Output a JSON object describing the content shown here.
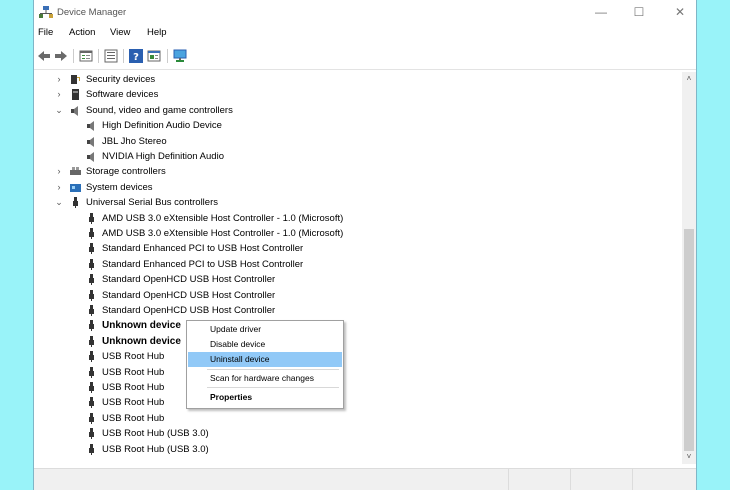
{
  "window": {
    "title": "Device Manager",
    "minimize": "—",
    "maximize": "☐",
    "close": "✕"
  },
  "menu": [
    "File",
    "Action",
    "View",
    "Help"
  ],
  "toolbar": [
    "back-icon",
    "forward-icon",
    "properties-view-icon",
    "console-tree-icon",
    "help-icon",
    "details-icon",
    "monitor-icon"
  ],
  "tree": [
    {
      "label": "Security devices",
      "chevron": "›",
      "icon": "security-device-icon",
      "level": 1
    },
    {
      "label": "Software devices",
      "chevron": "›",
      "icon": "software-device-icon",
      "level": 1
    },
    {
      "label": "Sound, video and game controllers",
      "chevron": "⌄",
      "icon": "speaker-icon",
      "level": 1
    },
    {
      "label": "High Definition Audio Device",
      "chevron": "",
      "icon": "speaker-icon",
      "level": 2
    },
    {
      "label": "JBL Jho Stereo",
      "chevron": "",
      "icon": "speaker-icon",
      "level": 2
    },
    {
      "label": "NVIDIA High Definition Audio",
      "chevron": "",
      "icon": "speaker-icon",
      "level": 2
    },
    {
      "label": "Storage controllers",
      "chevron": "›",
      "icon": "storage-controller-icon",
      "level": 1
    },
    {
      "label": "System devices",
      "chevron": "›",
      "icon": "system-device-icon",
      "level": 1
    },
    {
      "label": "Universal Serial Bus controllers",
      "chevron": "⌄",
      "icon": "usb-icon",
      "level": 1
    },
    {
      "label": "AMD USB 3.0 eXtensible Host Controller - 1.0 (Microsoft)",
      "chevron": "",
      "icon": "usb-icon",
      "level": 2
    },
    {
      "label": "AMD USB 3.0 eXtensible Host Controller - 1.0 (Microsoft)",
      "chevron": "",
      "icon": "usb-icon",
      "level": 2
    },
    {
      "label": "Standard Enhanced PCI to USB Host Controller",
      "chevron": "",
      "icon": "usb-icon",
      "level": 2
    },
    {
      "label": "Standard Enhanced PCI to USB Host Controller",
      "chevron": "",
      "icon": "usb-icon",
      "level": 2
    },
    {
      "label": "Standard OpenHCD USB Host Controller",
      "chevron": "",
      "icon": "usb-icon",
      "level": 2
    },
    {
      "label": "Standard OpenHCD USB Host Controller",
      "chevron": "",
      "icon": "usb-icon",
      "level": 2
    },
    {
      "label": "Standard OpenHCD USB Host Controller",
      "chevron": "",
      "icon": "usb-icon",
      "level": 2
    },
    {
      "label": "Unknown device",
      "chevron": "",
      "icon": "usb-icon",
      "level": 2,
      "bold": true
    },
    {
      "label": "Unknown device",
      "chevron": "",
      "icon": "usb-icon",
      "level": 2,
      "bold": true
    },
    {
      "label": "USB Root Hub",
      "chevron": "",
      "icon": "usb-icon",
      "level": 2
    },
    {
      "label": "USB Root Hub",
      "chevron": "",
      "icon": "usb-icon",
      "level": 2
    },
    {
      "label": "USB Root Hub",
      "chevron": "",
      "icon": "usb-icon",
      "level": 2
    },
    {
      "label": "USB Root Hub",
      "chevron": "",
      "icon": "usb-icon",
      "level": 2
    },
    {
      "label": "USB Root Hub",
      "chevron": "",
      "icon": "usb-icon",
      "level": 2
    },
    {
      "label": "USB Root Hub (USB 3.0)",
      "chevron": "",
      "icon": "usb-icon",
      "level": 2
    },
    {
      "label": "USB Root Hub (USB 3.0)",
      "chevron": "",
      "icon": "usb-icon",
      "level": 2
    }
  ],
  "context_menu": {
    "items": [
      {
        "label": "Update driver",
        "highlighted": false,
        "bold": false
      },
      {
        "label": "Disable device",
        "highlighted": false,
        "bold": false
      },
      {
        "label": "Uninstall device",
        "highlighted": true,
        "bold": false
      },
      {
        "label": "Scan for hardware changes",
        "highlighted": false,
        "bold": false
      },
      {
        "label": "Properties",
        "highlighted": false,
        "bold": true
      }
    ]
  },
  "scrollbar": {
    "up": "˄",
    "down": "˅"
  },
  "colors": {
    "background": "#99f3f9",
    "highlight": "#91c9f7"
  }
}
